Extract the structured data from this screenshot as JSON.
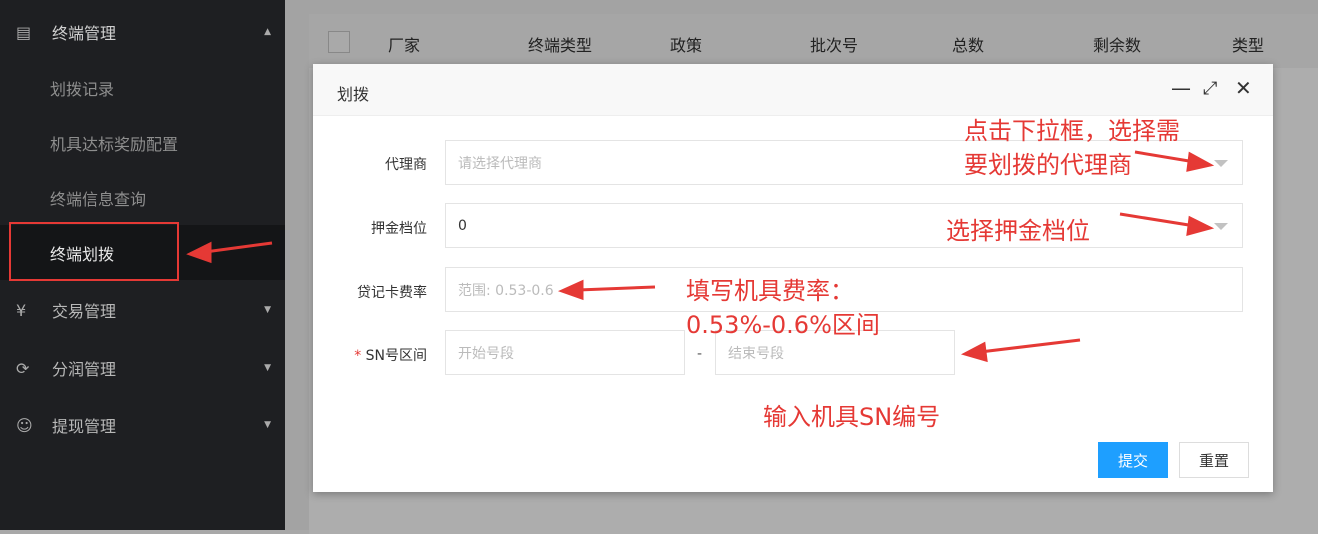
{
  "sidebar": {
    "group": {
      "label": "终端管理",
      "icon": "terminal-icon"
    },
    "sub_items": [
      {
        "label": "划拨记录"
      },
      {
        "label": "机具达标奖励配置"
      },
      {
        "label": "终端信息查询"
      },
      {
        "label": "终端划拨",
        "active": true
      }
    ],
    "menus": [
      {
        "label": "交易管理",
        "icon": "yen-icon"
      },
      {
        "label": "分润管理",
        "icon": "share-icon"
      },
      {
        "label": "提现管理",
        "icon": "smile-icon"
      }
    ]
  },
  "table": {
    "columns": [
      "厂家",
      "终端类型",
      "政策",
      "批次号",
      "总数",
      "剩余数",
      "类型"
    ]
  },
  "modal": {
    "title": "划拨",
    "fields": {
      "agent": {
        "label": "代理商",
        "placeholder": "请选择代理商"
      },
      "deposit": {
        "label": "押金档位",
        "value": "0"
      },
      "rate": {
        "label": "贷记卡费率",
        "placeholder": "范围: 0.53-0.6"
      },
      "sn": {
        "label": "SN号区间",
        "required_mark": "*",
        "start_placeholder": "开始号段",
        "separator": "-",
        "end_placeholder": "结束号段"
      }
    },
    "submit_label": "提交",
    "reset_label": "重置"
  },
  "annotations": {
    "agent_line1": "点击下拉框，选择需",
    "agent_line2": "要划拨的代理商",
    "deposit": "选择押金档位",
    "rate_line1": "填写机具费率：",
    "rate_line2": "0.53%-0.6%区间",
    "sn": "输入机具SN编号"
  },
  "colors": {
    "accent": "#1e9fff",
    "annotation": "#e53935"
  }
}
